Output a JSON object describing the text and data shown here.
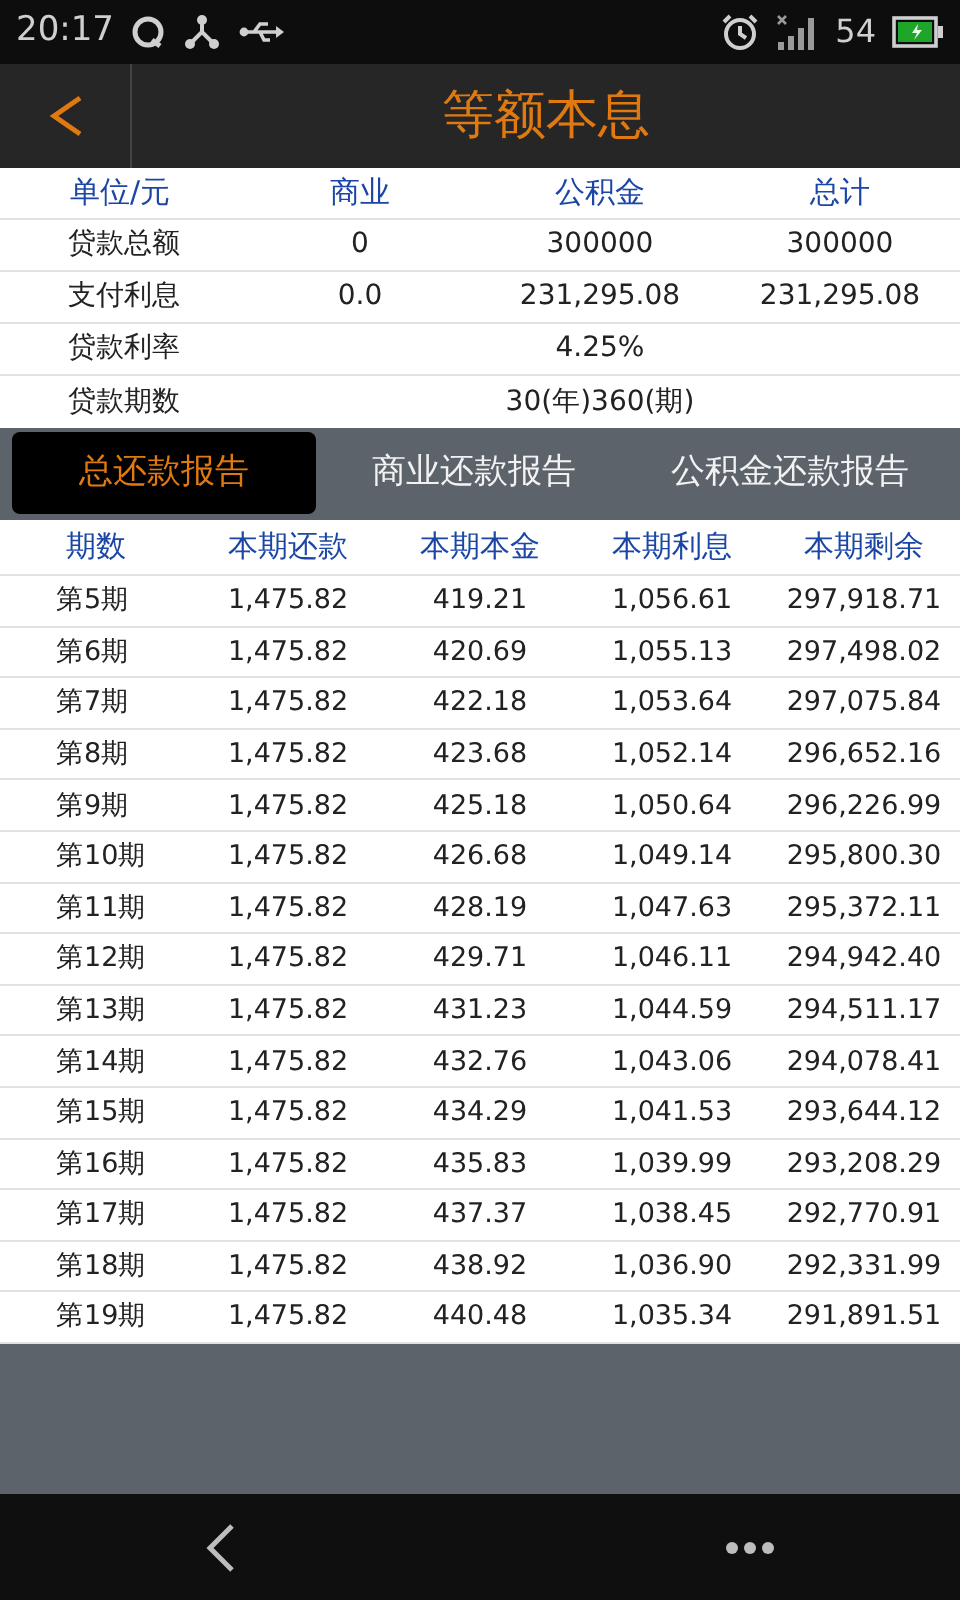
{
  "status_bar": {
    "time": "20:17",
    "signal_text": "54"
  },
  "header": {
    "title": "等额本息"
  },
  "summary": {
    "columns": [
      "单位/元",
      "商业",
      "公积金",
      "总计"
    ],
    "rows": [
      {
        "kind": "full",
        "cells": [
          "贷款总额",
          "0",
          "300000",
          "300000"
        ]
      },
      {
        "kind": "full",
        "cells": [
          "支付利息",
          "0.0",
          "231,295.08",
          "231,295.08"
        ]
      },
      {
        "kind": "span",
        "cells": [
          "贷款利率",
          "4.25%"
        ]
      },
      {
        "kind": "span",
        "cells": [
          "贷款期数",
          "30(年)360(期)"
        ]
      }
    ]
  },
  "tabs": [
    {
      "label": "总还款报告",
      "selected": true
    },
    {
      "label": "商业还款报告",
      "selected": false
    },
    {
      "label": "公积金还款报告",
      "selected": false
    }
  ],
  "report": {
    "columns": [
      "期数",
      "本期还款",
      "本期本金",
      "本期利息",
      "本期剩余"
    ],
    "rows": [
      [
        "第5期",
        "1,475.82",
        "419.21",
        "1,056.61",
        "297,918.71"
      ],
      [
        "第6期",
        "1,475.82",
        "420.69",
        "1,055.13",
        "297,498.02"
      ],
      [
        "第7期",
        "1,475.82",
        "422.18",
        "1,053.64",
        "297,075.84"
      ],
      [
        "第8期",
        "1,475.82",
        "423.68",
        "1,052.14",
        "296,652.16"
      ],
      [
        "第9期",
        "1,475.82",
        "425.18",
        "1,050.64",
        "296,226.99"
      ],
      [
        "第10期",
        "1,475.82",
        "426.68",
        "1,049.14",
        "295,800.30"
      ],
      [
        "第11期",
        "1,475.82",
        "428.19",
        "1,047.63",
        "295,372.11"
      ],
      [
        "第12期",
        "1,475.82",
        "429.71",
        "1,046.11",
        "294,942.40"
      ],
      [
        "第13期",
        "1,475.82",
        "431.23",
        "1,044.59",
        "294,511.17"
      ],
      [
        "第14期",
        "1,475.82",
        "432.76",
        "1,043.06",
        "294,078.41"
      ],
      [
        "第15期",
        "1,475.82",
        "434.29",
        "1,041.53",
        "293,644.12"
      ],
      [
        "第16期",
        "1,475.82",
        "435.83",
        "1,039.99",
        "293,208.29"
      ],
      [
        "第17期",
        "1,475.82",
        "437.37",
        "1,038.45",
        "292,770.91"
      ],
      [
        "第18期",
        "1,475.82",
        "438.92",
        "1,036.90",
        "292,331.99"
      ],
      [
        "第19期",
        "1,475.82",
        "440.48",
        "1,035.34",
        "291,891.51"
      ]
    ]
  }
}
